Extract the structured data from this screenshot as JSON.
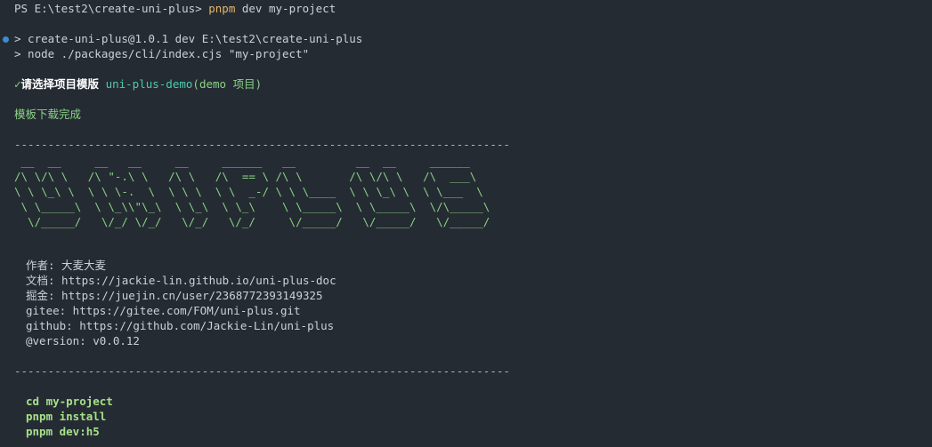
{
  "prompt": {
    "ps_path": "PS E:\\test2\\create-uni-plus> ",
    "command": "pnpm",
    "args": " dev my-project"
  },
  "script_lines": [
    "> create-uni-plus@1.0.1 dev E:\\test2\\create-uni-plus",
    "> node ./packages/cli/index.cjs \"my-project\""
  ],
  "template_select": {
    "check": "✓",
    "question": "请选择项目模版",
    "answer": "uni-plus-demo",
    "answer_suffix": "(demo 项目)"
  },
  "download_status": "模板下载完成",
  "divider": "--------------------------------------------------------------------------",
  "ascii_art": [
    " __  __     __   __     __     ______   __         __  __     ______    ",
    "/\\ \\/\\ \\   /\\ \"-.\\ \\   /\\ \\   /\\  == \\ /\\ \\       /\\ \\/\\ \\   /\\  ___\\   ",
    "\\ \\ \\_\\ \\  \\ \\ \\-.  \\  \\ \\ \\  \\ \\  _-/ \\ \\ \\____  \\ \\ \\_\\ \\  \\ \\___  \\  ",
    " \\ \\_____\\  \\ \\_\\\\\"\\_\\  \\ \\_\\  \\ \\_\\    \\ \\_____\\  \\ \\_____\\  \\/\\_____\\ ",
    "  \\/_____/   \\/_/ \\/_/   \\/_/   \\/_/     \\/_____/   \\/_____/   \\/_____/ "
  ],
  "info": [
    "作者: 大麦大麦",
    "文档: https://jackie-lin.github.io/uni-plus-doc",
    "掘金: https://juejin.cn/user/2368772393149325",
    "gitee: https://gitee.com/FOM/uni-plus.git",
    "github: https://github.com/Jackie-Lin/uni-plus",
    "@version: v0.0.12"
  ],
  "next_steps": [
    "cd my-project",
    "pnpm install",
    "pnpm dev:h5"
  ]
}
